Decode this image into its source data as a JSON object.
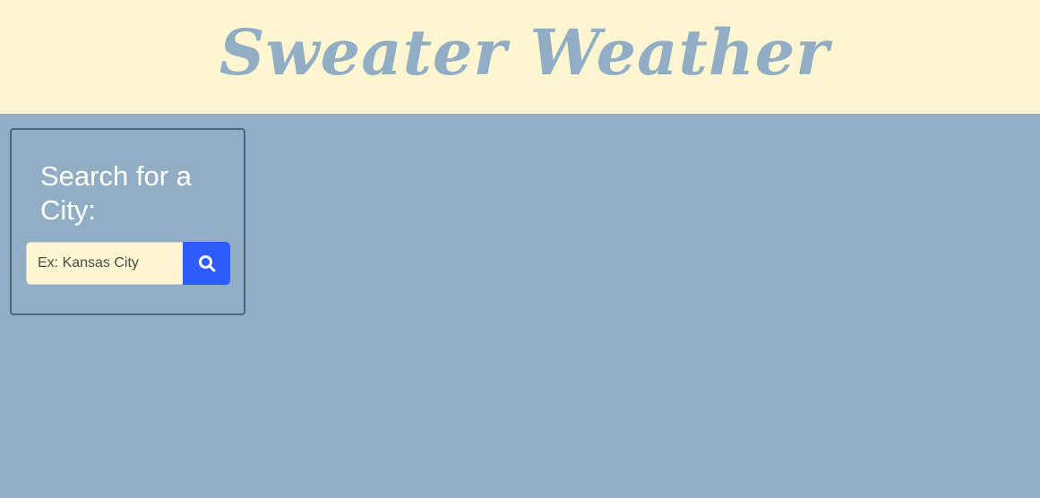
{
  "header": {
    "title": "Sweater Weather"
  },
  "search": {
    "heading": "Search for a City:",
    "placeholder": "Ex: Kansas City",
    "value": "",
    "button_icon": "search-icon"
  },
  "colors": {
    "header_background": "#fef6d0",
    "page_background": "#92aec5",
    "title_color": "#92aec5",
    "card_border": "#4a6782",
    "input_background": "#fef6d0",
    "button_background": "#2c5cff"
  }
}
